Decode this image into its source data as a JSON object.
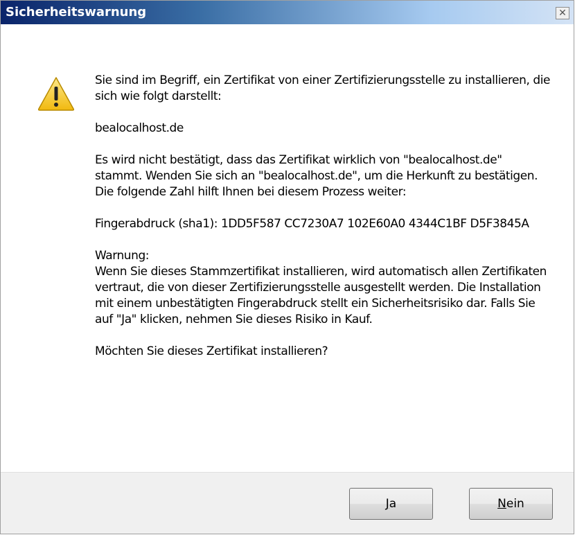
{
  "window": {
    "title": "Sicherheitswarnung",
    "close_glyph": "✕"
  },
  "icons": {
    "warning": "warning-triangle-icon"
  },
  "message": {
    "intro": "Sie sind im Begriff, ein Zertifikat von einer Zertifizierungsstelle zu installieren, die sich wie folgt darstellt:",
    "issuer": "bealocalhost.de",
    "not_confirmed": "Es wird nicht bestätigt, dass das Zertifikat wirklich von \"bealocalhost.de\" stammt. Wenden Sie sich an \"bealocalhost.de\", um die Herkunft zu bestätigen. Die folgende Zahl hilft Ihnen bei diesem Prozess weiter:",
    "fingerprint": "Fingerabdruck (sha1): 1DD5F587 CC7230A7 102E60A0 4344C1BF D5F3845A",
    "warning_heading": "Warnung:",
    "warning_text": "Wenn Sie dieses Stammzertifikat installieren, wird automatisch allen Zertifikaten vertraut, die von dieser Zertifizierungsstelle ausgestellt werden. Die Installation mit einem unbestätigten Fingerabdruck stellt ein Sicherheitsrisiko dar. Falls Sie auf \"Ja\" klicken, nehmen Sie dieses Risiko in Kauf.",
    "question": "Möchten Sie dieses Zertifikat installieren?"
  },
  "buttons": {
    "yes_mnemonic": "J",
    "yes_rest": "a",
    "no_mnemonic": "N",
    "no_rest": "ein"
  },
  "colors": {
    "titlebar_start": "#0a246a",
    "titlebar_end": "#d4e3f5",
    "footer_bg": "#f0f0f0",
    "warning_yellow": "#f5c518"
  }
}
